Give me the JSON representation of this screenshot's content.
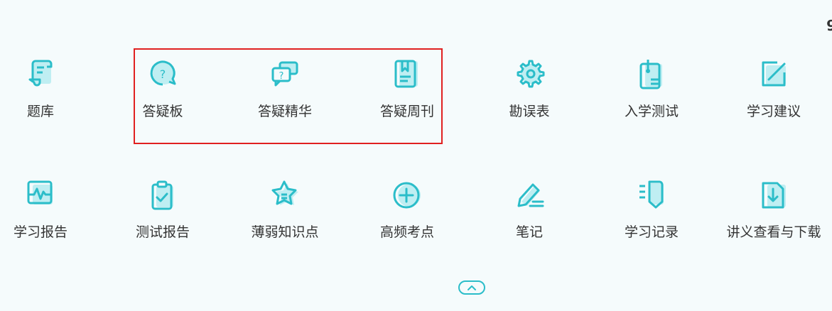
{
  "colors": {
    "accent": "#2bbdc9",
    "accent_light": "#bfeef2",
    "text": "#333333",
    "highlight": "#e02020",
    "background": "#f5fbfc"
  },
  "edge_text": "9",
  "rows": [
    [
      {
        "label": "题库",
        "icon": "scroll-icon"
      },
      {
        "label": "答疑板",
        "icon": "question-bubble-icon"
      },
      {
        "label": "答疑精华",
        "icon": "chat-question-icon"
      },
      {
        "label": "答疑周刊",
        "icon": "bookmark-book-icon"
      },
      {
        "label": "勘误表",
        "icon": "gear-icon"
      },
      {
        "label": "入学测试",
        "icon": "test-paper-icon"
      },
      {
        "label": "学习建议",
        "icon": "pen-square-icon"
      }
    ],
    [
      {
        "label": "学习报告",
        "icon": "pulse-chart-icon"
      },
      {
        "label": "测试报告",
        "icon": "clipboard-check-icon"
      },
      {
        "label": "薄弱知识点",
        "icon": "star-icon"
      },
      {
        "label": "高频考点",
        "icon": "plus-circle-icon"
      },
      {
        "label": "笔记",
        "icon": "pencil-icon"
      },
      {
        "label": "学习记录",
        "icon": "list-record-icon"
      },
      {
        "label": "讲义查看与下载",
        "icon": "download-doc-icon"
      }
    ]
  ]
}
